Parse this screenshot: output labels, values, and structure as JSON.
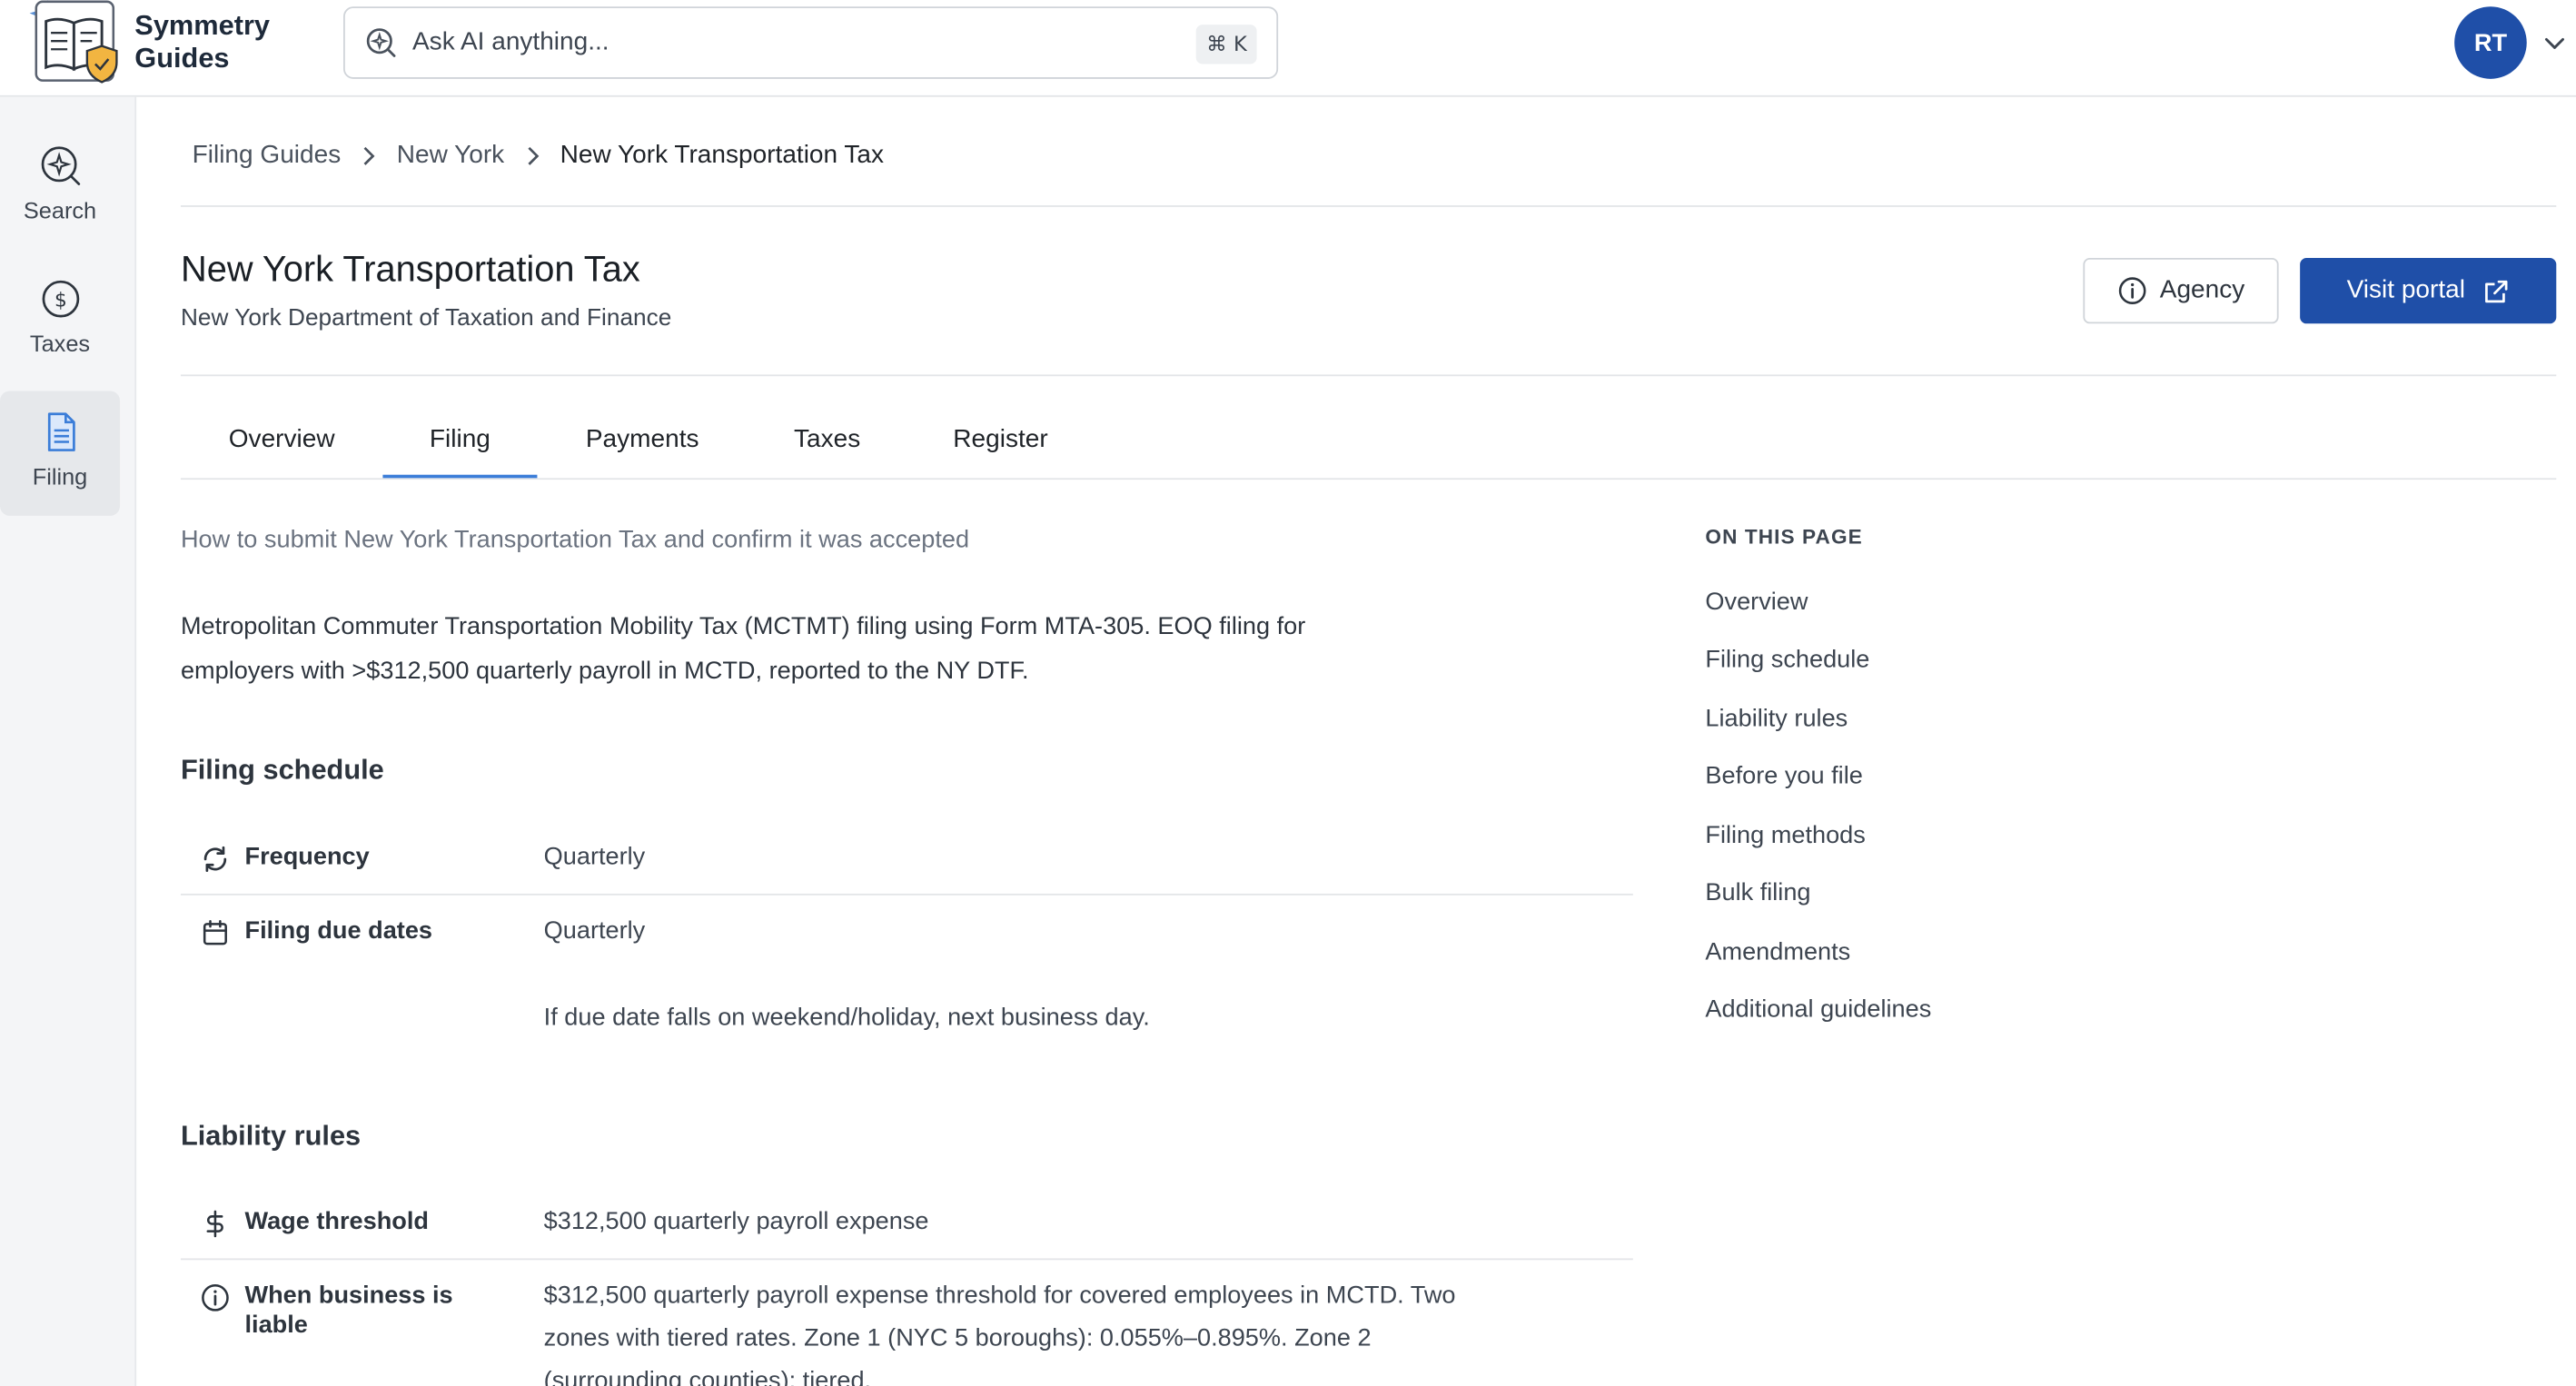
{
  "app": {
    "brand_line1": "Symmetry",
    "brand_line2": "Guides"
  },
  "search": {
    "placeholder": "Ask AI anything...",
    "shortcut": "⌘ K"
  },
  "user": {
    "initials": "RT"
  },
  "sidebar": {
    "items": [
      {
        "label": "Search",
        "icon": "sparkle-search-icon"
      },
      {
        "label": "Taxes",
        "icon": "dollar-circle-icon"
      },
      {
        "label": "Filing",
        "icon": "document-icon",
        "active": true
      }
    ]
  },
  "breadcrumb": {
    "items": [
      "Filing Guides",
      "New York",
      "New York Transportation Tax"
    ]
  },
  "page": {
    "title": "New York Transportation Tax",
    "subtitle": "New York Department of Taxation and Finance",
    "agency_label": "Agency",
    "portal_label": "Visit portal"
  },
  "tabs": [
    "Overview",
    "Filing",
    "Payments",
    "Taxes",
    "Register"
  ],
  "active_tab": "Filing",
  "content": {
    "intro": "How to submit New York Transportation Tax and confirm it was accepted",
    "description_line1": "Metropolitan Commuter Transportation Mobility Tax (MCTMT) filing using Form MTA-305. EOQ filing for",
    "description_line2": "employers with >$312,500 quarterly payroll in MCTD, reported to the NY DTF.",
    "filing_schedule": {
      "heading": "Filing schedule",
      "frequency_label": "Frequency",
      "frequency_value": "Quarterly",
      "due_dates_label": "Filing due dates",
      "due_dates_value": "Quarterly",
      "due_dates_note": "If due date falls on weekend/holiday, next business day."
    },
    "liability_rules": {
      "heading": "Liability rules",
      "wage_threshold_label": "Wage threshold",
      "wage_threshold_value": "$312,500 quarterly payroll expense",
      "when_liable_label_line1": "When business is",
      "when_liable_label_line2": "liable",
      "when_liable_line1": "$312,500 quarterly payroll expense threshold for covered employees in MCTD. Two",
      "when_liable_line2": "zones with tiered rates. Zone 1 (NYC 5 boroughs): 0.055%–0.895%. Zone 2",
      "when_liable_line3": "(surrounding counties): tiered."
    }
  },
  "toc": {
    "heading": "ON THIS PAGE",
    "items": [
      "Overview",
      "Filing schedule",
      "Liability rules",
      "Before you file",
      "Filing methods",
      "Bulk filing",
      "Amendments",
      "Additional guidelines"
    ]
  },
  "colors": {
    "primary": "#1f4fa8",
    "tab_underline": "#3b7dd8",
    "shield": "#f2b541"
  }
}
